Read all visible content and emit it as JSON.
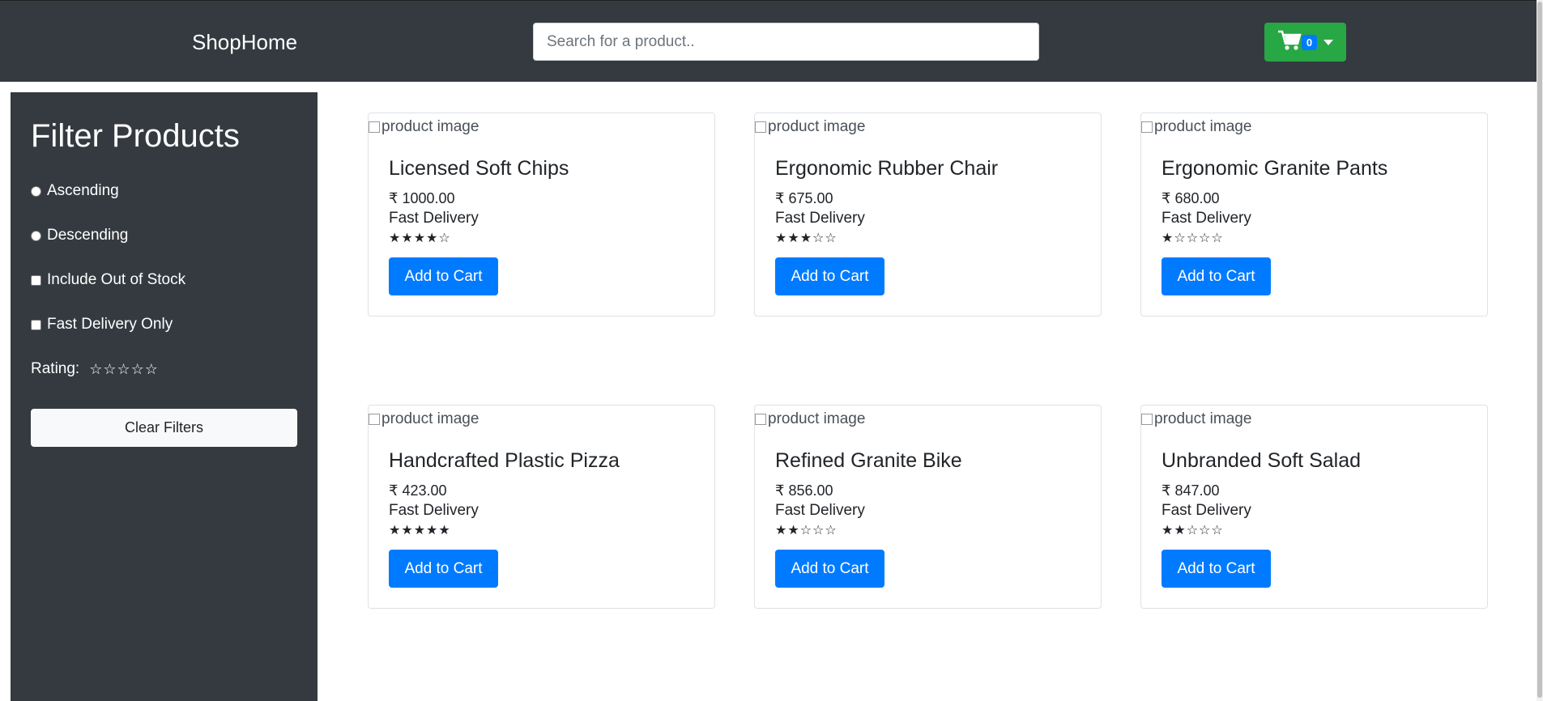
{
  "navbar": {
    "brand": "ShopHome",
    "search_placeholder": "Search for a product..",
    "cart_icon": "shopping-cart-icon",
    "cart_count": "0",
    "colors": {
      "background": "#343a40",
      "cart_button": "#28a745",
      "badge": "#007bff"
    }
  },
  "sidebar": {
    "title": "Filter Products",
    "sort_ascending": "Ascending",
    "sort_descending": "Descending",
    "include_out_of_stock": "Include Out of Stock",
    "fast_delivery_only": "Fast Delivery Only",
    "rating_label": "Rating:",
    "rating_value": 0,
    "rating_max": 5,
    "clear_button": "Clear Filters"
  },
  "products": [
    {
      "image_alt": "product image",
      "name": "Licensed Soft Chips",
      "price": "₹ 1000.00",
      "delivery": "Fast Delivery",
      "rating": 4,
      "button": "Add to Cart"
    },
    {
      "image_alt": "product image",
      "name": "Ergonomic Rubber Chair",
      "price": "₹ 675.00",
      "delivery": "Fast Delivery",
      "rating": 3,
      "button": "Add to Cart"
    },
    {
      "image_alt": "product image",
      "name": "Ergonomic Granite Pants",
      "price": "₹ 680.00",
      "delivery": "Fast Delivery",
      "rating": 1,
      "button": "Add to Cart"
    },
    {
      "image_alt": "product image",
      "name": "Handcrafted Plastic Pizza",
      "price": "₹ 423.00",
      "delivery": "Fast Delivery",
      "rating": 5,
      "button": "Add to Cart"
    },
    {
      "image_alt": "product image",
      "name": "Refined Granite Bike",
      "price": "₹ 856.00",
      "delivery": "Fast Delivery",
      "rating": 2,
      "button": "Add to Cart"
    },
    {
      "image_alt": "product image",
      "name": "Unbranded Soft Salad",
      "price": "₹ 847.00",
      "delivery": "Fast Delivery",
      "rating": 2,
      "button": "Add to Cart"
    }
  ],
  "colors": {
    "accent": "#007bff",
    "sidebar": "#343a40",
    "card_border": "#dee2e6"
  }
}
